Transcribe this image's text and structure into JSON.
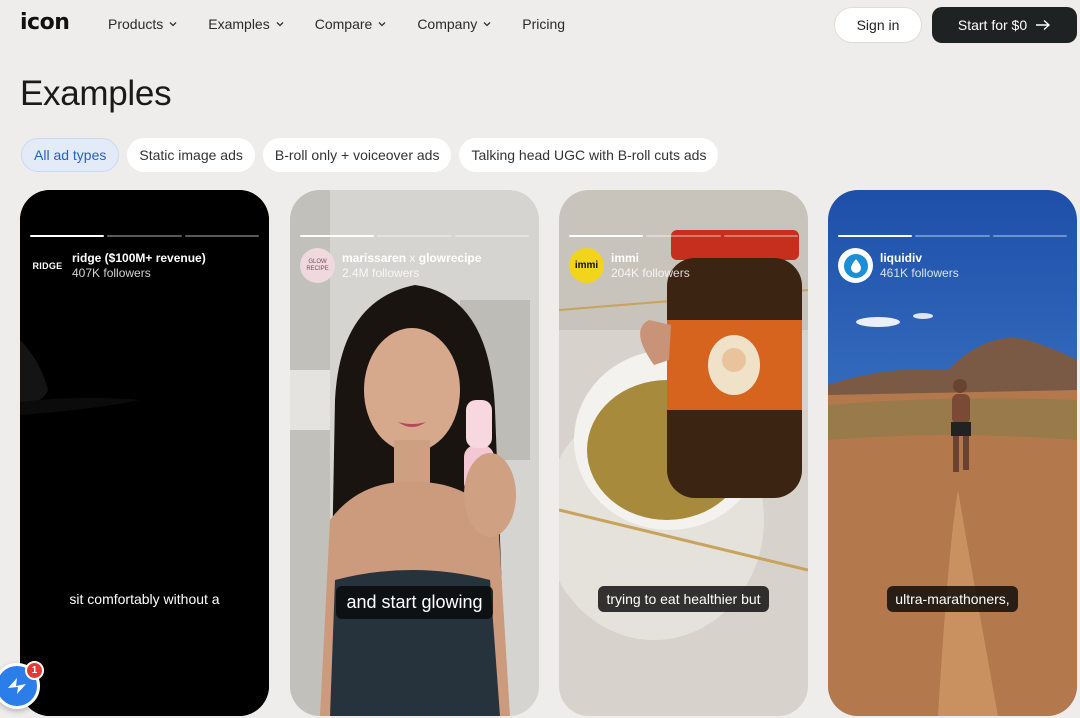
{
  "brand": {
    "logo": "icon"
  },
  "nav": {
    "items": [
      {
        "label": "Products",
        "has_dropdown": true
      },
      {
        "label": "Examples",
        "has_dropdown": true
      },
      {
        "label": "Compare",
        "has_dropdown": true
      },
      {
        "label": "Company",
        "has_dropdown": true
      },
      {
        "label": "Pricing",
        "has_dropdown": false
      }
    ],
    "sign_in": "Sign in",
    "cta": "Start for $0"
  },
  "page": {
    "title": "Examples"
  },
  "filters": [
    {
      "label": "All ad types",
      "active": true
    },
    {
      "label": "Static image ads",
      "active": false
    },
    {
      "label": "B-roll only + voiceover ads",
      "active": false
    },
    {
      "label": "Talking head UGC with B-roll cuts ads",
      "active": false
    }
  ],
  "cards": [
    {
      "account": "ridge ($100M+ revenue)",
      "followers": "407K followers",
      "avatar_text": "RIDGE",
      "caption": "sit comfortably without a",
      "segments_on": 1
    },
    {
      "account": "marissaren",
      "collab": "x",
      "collab_account": "glowrecipe",
      "followers": "2.4M followers",
      "avatar_text": "GLOW RECIPE",
      "caption": "and start glowing",
      "segments_on": 1
    },
    {
      "account": "immi",
      "followers": "204K followers",
      "avatar_text": "immi",
      "caption": "trying to eat healthier but",
      "segments_on": 1
    },
    {
      "account": "liquidiv",
      "followers": "461K followers",
      "avatar_text": "",
      "caption": "ultra-marathoners,",
      "segments_on": 1
    }
  ],
  "widget": {
    "badge_count": "1"
  },
  "colors": {
    "background": "#efedeb",
    "cta": "#1e2222",
    "active_chip": "#e3ebf8",
    "active_chip_text": "#2a5fc4",
    "badge": "#e53935"
  }
}
